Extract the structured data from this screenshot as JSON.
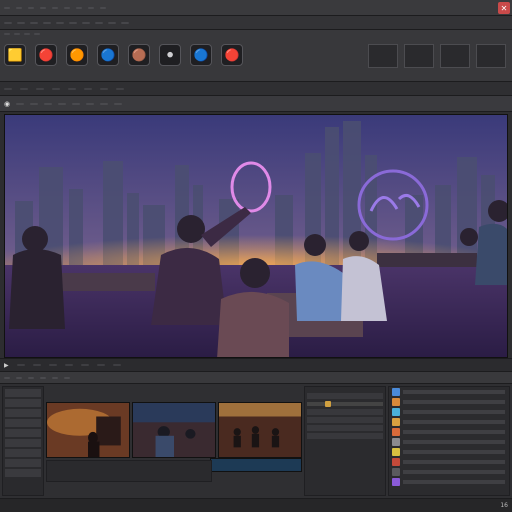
{
  "menubar": {
    "items": []
  },
  "colors": {
    "accent": "#d0a040",
    "sky_top": "#3a3a7a",
    "sky_glow": "#f0a040",
    "neon_ring": "#c46adf",
    "neon_ring2": "#7a5ad8",
    "floor": "#5a3f7a"
  },
  "icons": {
    "close": "close-icon",
    "play": "play-icon",
    "record": "record-icon"
  },
  "effects": {
    "thumb_icons": [
      "🟨",
      "🔴",
      "🟠",
      "🔵",
      "🟤",
      "⚫",
      "🔵",
      "🔴",
      "⚪",
      "🟫"
    ]
  },
  "statusbar": {
    "right": "16"
  }
}
